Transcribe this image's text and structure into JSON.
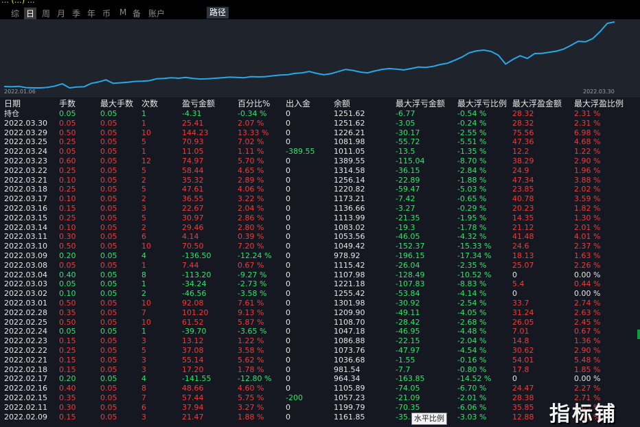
{
  "title": "… (…) …",
  "periods": [
    {
      "label": "综",
      "selected": false
    },
    {
      "label": "日",
      "selected": true
    },
    {
      "label": "周",
      "selected": false
    },
    {
      "label": "月",
      "selected": false
    },
    {
      "label": "季",
      "selected": false
    },
    {
      "label": "年",
      "selected": false
    },
    {
      "label": "币",
      "selected": false
    },
    {
      "label": "M",
      "selected": false
    },
    {
      "label": "备",
      "selected": false
    },
    {
      "label": "账户",
      "selected": false
    }
  ],
  "path_button": "路径",
  "chart": {
    "start_date": "2022.01.06",
    "end_date": "2022.03.30",
    "line_color": "#29a8e8",
    "values": [
      1001,
      1000,
      1002,
      997,
      996,
      996,
      998,
      1003,
      1011,
      996,
      999,
      1000,
      1013,
      1018,
      1026,
      1013,
      1015,
      1017,
      1020,
      1021,
      1023,
      1030,
      1031,
      1034,
      1032,
      1035,
      1031,
      1029,
      1030,
      1032,
      1034,
      1036,
      1035,
      1034,
      1038,
      1037,
      1038,
      1041,
      1044,
      1045,
      1050,
      1052,
      1057,
      1050,
      1045,
      1049,
      1057,
      1065,
      1061,
      1055,
      1052,
      1059,
      1065,
      1068,
      1066,
      1063,
      1068,
      1074,
      1072,
      1076,
      1083,
      1088,
      1099,
      1111,
      1127,
      1134,
      1137,
      1132,
      1118,
      1085,
      1102,
      1116,
      1106,
      1124,
      1125,
      1129,
      1133,
      1141,
      1155,
      1170,
      1168,
      1180,
      1206,
      1237,
      1242
    ]
  },
  "columns": [
    "日期",
    "手数",
    "最大手数",
    "次数",
    "盈亏金额",
    "百分比%",
    "出入金",
    "余额",
    "最大浮亏金额",
    "最大浮亏比例",
    "最大浮盈金额",
    "最大浮盈比例"
  ],
  "rows": [
    {
      "date": "持仓",
      "lots": "0.05",
      "max_lots": "0.05",
      "count": "1",
      "pnl": "-4.31",
      "pct": "-0.34 %",
      "flow": "0",
      "balance": "1251.62",
      "max_loss": "-6.77",
      "max_loss_pct": "-0.54 %",
      "max_gain": "28.32",
      "max_gain_pct": "2.31 %",
      "color": "green"
    },
    {
      "date": "2022.03.30",
      "lots": "0.05",
      "max_lots": "0.05",
      "count": "1",
      "pnl": "25.41",
      "pct": "2.07 %",
      "flow": "0",
      "balance": "1251.62",
      "max_loss": "-3.05",
      "max_loss_pct": "-0.24 %",
      "max_gain": "28.32",
      "max_gain_pct": "2.31 %",
      "color": "red"
    },
    {
      "date": "2022.03.29",
      "lots": "0.50",
      "max_lots": "0.05",
      "count": "10",
      "pnl": "144.23",
      "pct": "13.33 %",
      "flow": "0",
      "balance": "1226.21",
      "max_loss": "-30.17",
      "max_loss_pct": "-2.55 %",
      "max_gain": "75.56",
      "max_gain_pct": "6.98 %",
      "color": "red"
    },
    {
      "date": "2022.03.25",
      "lots": "0.25",
      "max_lots": "0.05",
      "count": "5",
      "pnl": "70.93",
      "pct": "7.02 %",
      "flow": "0",
      "balance": "1081.98",
      "max_loss": "-55.72",
      "max_loss_pct": "-5.51 %",
      "max_gain": "47.36",
      "max_gain_pct": "4.68 %",
      "color": "red"
    },
    {
      "date": "2022.03.24",
      "lots": "0.05",
      "max_lots": "0.05",
      "count": "1",
      "pnl": "11.05",
      "pct": "1.11 %",
      "flow": "-389.55",
      "balance": "1011.05",
      "max_loss": "-13.5",
      "max_loss_pct": "-1.35 %",
      "max_gain": "12.2",
      "max_gain_pct": "1.22 %",
      "color": "red"
    },
    {
      "date": "2022.03.23",
      "lots": "0.60",
      "max_lots": "0.05",
      "count": "12",
      "pnl": "74.97",
      "pct": "5.70 %",
      "flow": "0",
      "balance": "1389.55",
      "max_loss": "-115.04",
      "max_loss_pct": "-8.70 %",
      "max_gain": "38.29",
      "max_gain_pct": "2.90 %",
      "color": "red"
    },
    {
      "date": "2022.03.22",
      "lots": "0.25",
      "max_lots": "0.05",
      "count": "5",
      "pnl": "58.44",
      "pct": "4.65 %",
      "flow": "0",
      "balance": "1314.58",
      "max_loss": "-36.15",
      "max_loss_pct": "-2.84 %",
      "max_gain": "24.9",
      "max_gain_pct": "1.96 %",
      "color": "red"
    },
    {
      "date": "2022.03.21",
      "lots": "0.10",
      "max_lots": "0.05",
      "count": "2",
      "pnl": "35.32",
      "pct": "2.89 %",
      "flow": "0",
      "balance": "1256.14",
      "max_loss": "-22.89",
      "max_loss_pct": "-1.88 %",
      "max_gain": "47.34",
      "max_gain_pct": "3.88 %",
      "color": "red"
    },
    {
      "date": "2022.03.18",
      "lots": "0.25",
      "max_lots": "0.05",
      "count": "5",
      "pnl": "47.61",
      "pct": "4.06 %",
      "flow": "0",
      "balance": "1220.82",
      "max_loss": "-59.47",
      "max_loss_pct": "-5.03 %",
      "max_gain": "23.85",
      "max_gain_pct": "2.02 %",
      "color": "red"
    },
    {
      "date": "2022.03.17",
      "lots": "0.10",
      "max_lots": "0.05",
      "count": "2",
      "pnl": "36.55",
      "pct": "3.22 %",
      "flow": "0",
      "balance": "1173.21",
      "max_loss": "-7.42",
      "max_loss_pct": "-0.65 %",
      "max_gain": "40.78",
      "max_gain_pct": "3.59 %",
      "color": "red"
    },
    {
      "date": "2022.03.16",
      "lots": "0.15",
      "max_lots": "0.05",
      "count": "3",
      "pnl": "22.67",
      "pct": "2.04 %",
      "flow": "0",
      "balance": "1136.66",
      "max_loss": "-3.27",
      "max_loss_pct": "-0.29 %",
      "max_gain": "20.23",
      "max_gain_pct": "1.82 %",
      "color": "red"
    },
    {
      "date": "2022.03.15",
      "lots": "0.25",
      "max_lots": "0.05",
      "count": "5",
      "pnl": "30.97",
      "pct": "2.86 %",
      "flow": "0",
      "balance": "1113.99",
      "max_loss": "-21.35",
      "max_loss_pct": "-1.95 %",
      "max_gain": "14.35",
      "max_gain_pct": "1.30 %",
      "color": "red"
    },
    {
      "date": "2022.03.14",
      "lots": "0.10",
      "max_lots": "0.05",
      "count": "2",
      "pnl": "29.46",
      "pct": "2.80 %",
      "flow": "0",
      "balance": "1083.02",
      "max_loss": "-19.3",
      "max_loss_pct": "-1.78 %",
      "max_gain": "21.12",
      "max_gain_pct": "2.01 %",
      "color": "red"
    },
    {
      "date": "2022.03.11",
      "lots": "0.30",
      "max_lots": "0.05",
      "count": "6",
      "pnl": "4.14",
      "pct": "0.39 %",
      "flow": "0",
      "balance": "1053.56",
      "max_loss": "-46.05",
      "max_loss_pct": "-4.32 %",
      "max_gain": "41.48",
      "max_gain_pct": "4.01 %",
      "color": "red"
    },
    {
      "date": "2022.03.10",
      "lots": "0.50",
      "max_lots": "0.05",
      "count": "10",
      "pnl": "70.50",
      "pct": "7.20 %",
      "flow": "0",
      "balance": "1049.42",
      "max_loss": "-152.37",
      "max_loss_pct": "-15.33 %",
      "max_gain": "24.6",
      "max_gain_pct": "2.37 %",
      "color": "red"
    },
    {
      "date": "2022.03.09",
      "lots": "0.20",
      "max_lots": "0.05",
      "count": "4",
      "pnl": "-136.50",
      "pct": "-12.24 %",
      "flow": "0",
      "balance": "978.92",
      "max_loss": "-196.15",
      "max_loss_pct": "-17.34 %",
      "max_gain": "18.13",
      "max_gain_pct": "1.63 %",
      "color": "green"
    },
    {
      "date": "2022.03.08",
      "lots": "0.05",
      "max_lots": "0.05",
      "count": "1",
      "pnl": "7.44",
      "pct": "0.67 %",
      "flow": "0",
      "balance": "1115.42",
      "max_loss": "-26.04",
      "max_loss_pct": "-2.35 %",
      "max_gain": "25.07",
      "max_gain_pct": "2.26 %",
      "color": "red"
    },
    {
      "date": "2022.03.04",
      "lots": "0.40",
      "max_lots": "0.05",
      "count": "8",
      "pnl": "-113.20",
      "pct": "-9.27 %",
      "flow": "0",
      "balance": "1107.98",
      "max_loss": "-128.49",
      "max_loss_pct": "-10.52 %",
      "max_gain": "0",
      "max_gain_pct": "0.00 %",
      "color": "green"
    },
    {
      "date": "2022.03.03",
      "lots": "0.05",
      "max_lots": "0.05",
      "count": "1",
      "pnl": "-34.24",
      "pct": "-2.73 %",
      "flow": "0",
      "balance": "1221.18",
      "max_loss": "-107.83",
      "max_loss_pct": "-8.83 %",
      "max_gain": "5.4",
      "max_gain_pct": "0.44 %",
      "color": "green"
    },
    {
      "date": "2022.03.02",
      "lots": "0.10",
      "max_lots": "0.05",
      "count": "2",
      "pnl": "-46.56",
      "pct": "-3.58 %",
      "flow": "0",
      "balance": "1255.42",
      "max_loss": "-53.84",
      "max_loss_pct": "-4.14 %",
      "max_gain": "0",
      "max_gain_pct": "0.00 %",
      "color": "green"
    },
    {
      "date": "2022.03.01",
      "lots": "0.50",
      "max_lots": "0.05",
      "count": "10",
      "pnl": "92.08",
      "pct": "7.61 %",
      "flow": "0",
      "balance": "1301.98",
      "max_loss": "-30.92",
      "max_loss_pct": "-2.54 %",
      "max_gain": "33.7",
      "max_gain_pct": "2.74 %",
      "color": "red"
    },
    {
      "date": "2022.02.28",
      "lots": "0.35",
      "max_lots": "0.05",
      "count": "7",
      "pnl": "101.20",
      "pct": "9.13 %",
      "flow": "0",
      "balance": "1209.90",
      "max_loss": "-49.11",
      "max_loss_pct": "-4.05 %",
      "max_gain": "31.24",
      "max_gain_pct": "2.63 %",
      "color": "red"
    },
    {
      "date": "2022.02.25",
      "lots": "0.50",
      "max_lots": "0.05",
      "count": "10",
      "pnl": "61.52",
      "pct": "5.87 %",
      "flow": "0",
      "balance": "1108.70",
      "max_loss": "-28.42",
      "max_loss_pct": "-2.68 %",
      "max_gain": "26.05",
      "max_gain_pct": "2.45 %",
      "color": "red"
    },
    {
      "date": "2022.02.24",
      "lots": "0.05",
      "max_lots": "0.05",
      "count": "1",
      "pnl": "-39.70",
      "pct": "-3.65 %",
      "flow": "0",
      "balance": "1047.18",
      "max_loss": "-46.95",
      "max_loss_pct": "-4.48 %",
      "max_gain": "7.01",
      "max_gain_pct": "0.67 %",
      "color": "green"
    },
    {
      "date": "2022.02.23",
      "lots": "0.15",
      "max_lots": "0.05",
      "count": "3",
      "pnl": "13.12",
      "pct": "1.22 %",
      "flow": "0",
      "balance": "1086.88",
      "max_loss": "-22.15",
      "max_loss_pct": "-2.04 %",
      "max_gain": "14.8",
      "max_gain_pct": "1.36 %",
      "color": "red"
    },
    {
      "date": "2022.02.22",
      "lots": "0.25",
      "max_lots": "0.05",
      "count": "5",
      "pnl": "37.08",
      "pct": "3.58 %",
      "flow": "0",
      "balance": "1073.76",
      "max_loss": "-47.97",
      "max_loss_pct": "-4.54 %",
      "max_gain": "30.62",
      "max_gain_pct": "2.90 %",
      "color": "red"
    },
    {
      "date": "2022.02.21",
      "lots": "0.15",
      "max_lots": "0.05",
      "count": "3",
      "pnl": "55.14",
      "pct": "5.62 %",
      "flow": "0",
      "balance": "1036.68",
      "max_loss": "-1.55",
      "max_loss_pct": "-0.16 %",
      "max_gain": "54.01",
      "max_gain_pct": "5.48 %",
      "color": "red"
    },
    {
      "date": "2022.02.18",
      "lots": "0.15",
      "max_lots": "0.05",
      "count": "3",
      "pnl": "17.20",
      "pct": "1.78 %",
      "flow": "0",
      "balance": "981.54",
      "max_loss": "-7.7",
      "max_loss_pct": "-0.80 %",
      "max_gain": "17.8",
      "max_gain_pct": "1.85 %",
      "color": "red"
    },
    {
      "date": "2022.02.17",
      "lots": "0.20",
      "max_lots": "0.05",
      "count": "4",
      "pnl": "-141.55",
      "pct": "-12.80 %",
      "flow": "0",
      "balance": "964.34",
      "max_loss": "-163.85",
      "max_loss_pct": "-14.52 %",
      "max_gain": "0",
      "max_gain_pct": "0.00 %",
      "color": "green"
    },
    {
      "date": "2022.02.16",
      "lots": "0.40",
      "max_lots": "0.05",
      "count": "8",
      "pnl": "48.66",
      "pct": "4.60 %",
      "flow": "0",
      "balance": "1105.89",
      "max_loss": "-74.05",
      "max_loss_pct": "-6.70 %",
      "max_gain": "24.47",
      "max_gain_pct": "2.27 %",
      "color": "red"
    },
    {
      "date": "2022.02.15",
      "lots": "0.35",
      "max_lots": "0.05",
      "count": "7",
      "pnl": "57.44",
      "pct": "5.75 %",
      "flow": "-200",
      "balance": "1057.23",
      "max_loss": "-21.09",
      "max_loss_pct": "-2.01 %",
      "max_gain": "28.38",
      "max_gain_pct": "2.71 %",
      "color": "red"
    },
    {
      "date": "2022.02.11",
      "lots": "0.30",
      "max_lots": "0.05",
      "count": "6",
      "pnl": "37.94",
      "pct": "3.27 %",
      "flow": "0",
      "balance": "1199.79",
      "max_loss": "-70.35",
      "max_loss_pct": "-6.06 %",
      "max_gain": "35.85",
      "max_gain_pct": "3.09 %",
      "color": "red"
    },
    {
      "date": "2022.02.09",
      "lots": "0.15",
      "max_lots": "0.05",
      "count": "3",
      "pnl": "21.47",
      "pct": "1.88 %",
      "flow": "0",
      "balance": "1161.85",
      "max_loss": "-35.1",
      "max_loss_pct": "-3.03 %",
      "max_gain": "12.88",
      "max_gain_pct": "1.11 %",
      "color": "red"
    }
  ],
  "tooltip": "水平比例",
  "watermark": "指标铺"
}
